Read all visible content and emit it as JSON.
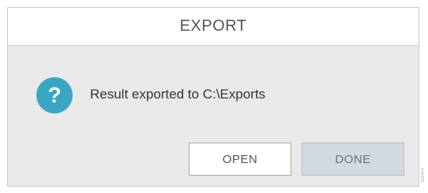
{
  "dialog": {
    "title": "EXPORT",
    "message": "Result exported to C:\\Exports",
    "icon": "question-mark-icon",
    "icon_glyph": "?",
    "icon_color": "#3aa6c4",
    "buttons": {
      "open_label": "OPEN",
      "done_label": "DONE"
    }
  },
  "side_label": "S14474"
}
